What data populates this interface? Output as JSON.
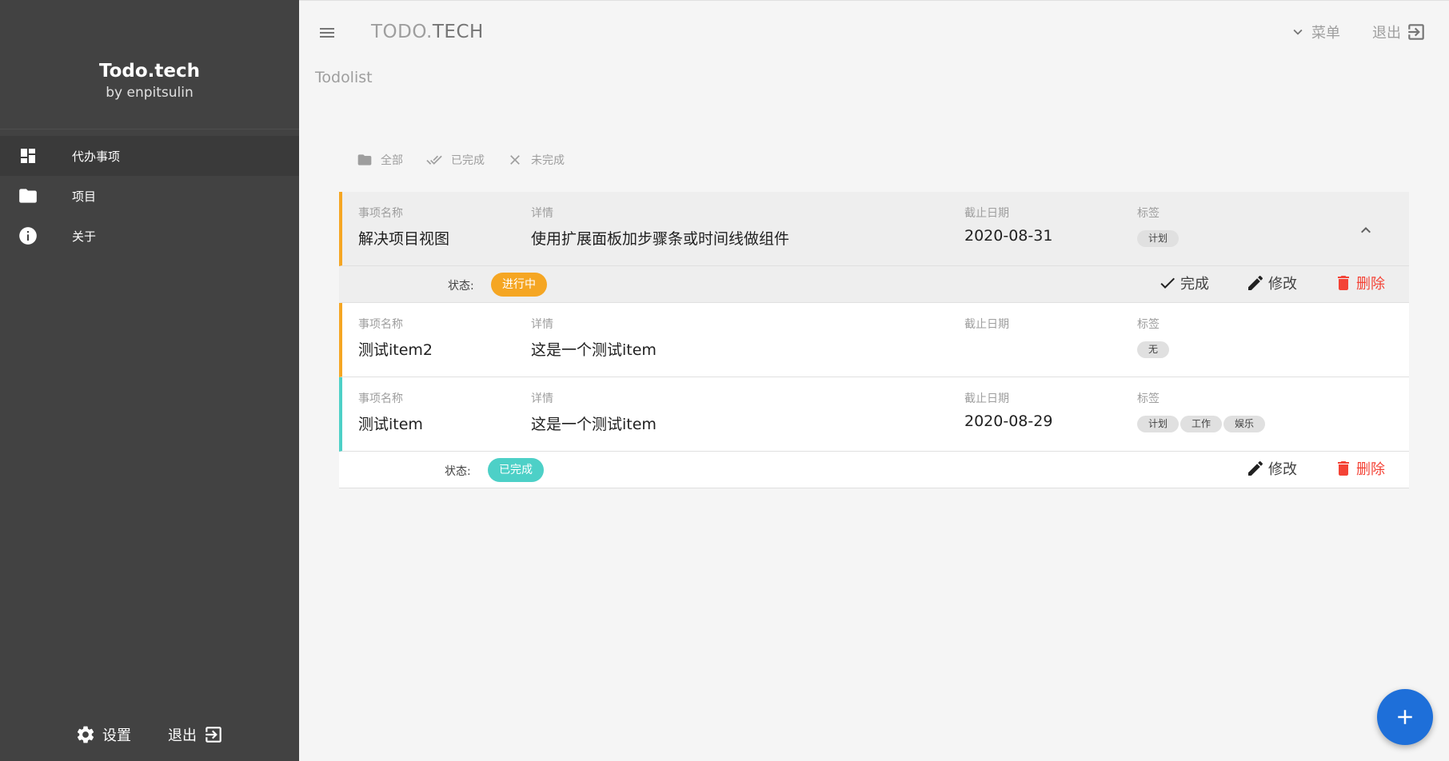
{
  "sidebar": {
    "brand_title": "Todo.tech",
    "brand_sub": "by enpitsulin",
    "items": [
      {
        "label": "代办事项",
        "icon": "dashboard-icon"
      },
      {
        "label": "项目",
        "icon": "folder-icon"
      },
      {
        "label": "关于",
        "icon": "info-icon"
      }
    ],
    "settings_label": "设置",
    "logout_label": "退出"
  },
  "header": {
    "title_prefix": "TODO.",
    "title_suffix": "TECH",
    "menu_label": "菜单",
    "logout_label": "退出",
    "subtitle": "Todolist"
  },
  "filters": [
    {
      "label": "全部",
      "icon": "folder-icon"
    },
    {
      "label": "已完成",
      "icon": "double-check-icon"
    },
    {
      "label": "未完成",
      "icon": "close-icon"
    }
  ],
  "columns": {
    "name": "事项名称",
    "detail": "详情",
    "due": "截止日期",
    "tags": "标签"
  },
  "todos": [
    {
      "name": "解决项目视图",
      "detail": "使用扩展面板加步骤条或时间线做组件",
      "due": "2020-08-31",
      "tags": [
        "计划"
      ],
      "expanded": true,
      "status_label": "状态:",
      "status": "进行中",
      "status_color": "#f5a623",
      "complete_label": "完成",
      "edit_label": "修改",
      "delete_label": "删除"
    },
    {
      "name": "测试item2",
      "detail": "这是一个测试item",
      "due": "",
      "tags": [
        "无"
      ]
    },
    {
      "name": "测试item",
      "detail": "这是一个测试item",
      "due": "2020-08-29",
      "tags": [
        "计划",
        "工作",
        "娱乐"
      ],
      "expanded": true,
      "status_label": "状态:",
      "status": "已完成",
      "status_color": "#4dd0c7",
      "edit_label": "修改",
      "delete_label": "删除"
    }
  ],
  "colors": {
    "sidebar": "#424242",
    "accent": "#1e6fd9",
    "pending": "#f5a623",
    "done": "#4dd0c7",
    "danger": "#f44336"
  }
}
